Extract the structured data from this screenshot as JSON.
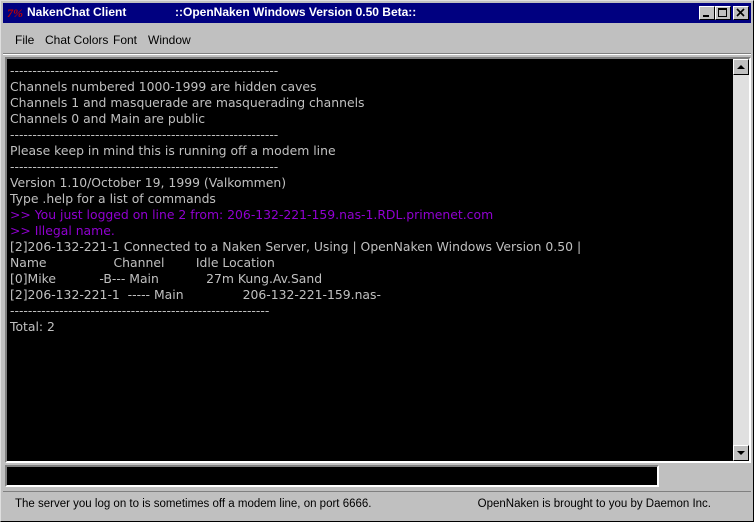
{
  "window": {
    "app_title": "NakenChat Client",
    "doc_title": "::OpenNaken Windows Version 0.50 Beta::",
    "icon_glyph": "7%"
  },
  "menu": {
    "file": "File",
    "chat_colors": "Chat Colors",
    "font": "Font",
    "window": "Window"
  },
  "output": {
    "background": "#000000",
    "text_color": "#c0c0c0",
    "highlight_color": "#9000d0",
    "lines": [
      {
        "text": "------------------------------------------------------------",
        "style": "normal"
      },
      {
        "text": "Channels numbered 1000-1999 are hidden caves",
        "style": "normal"
      },
      {
        "text": "Channels 1 and masquerade are masquerading channels",
        "style": "normal"
      },
      {
        "text": "Channels 0 and Main are public",
        "style": "normal"
      },
      {
        "text": "------------------------------------------------------------",
        "style": "normal"
      },
      {
        "text": "Please keep in mind this is running off a modem line",
        "style": "normal"
      },
      {
        "text": "------------------------------------------------------------",
        "style": "normal"
      },
      {
        "text": "Version 1.10/October 19, 1999 (Valkommen)",
        "style": "normal"
      },
      {
        "text": "Type .help for a list of commands",
        "style": "normal"
      },
      {
        "text": ">> You just logged on line 2 from: 206-132-221-159.nas-1.RDL.primenet.com",
        "style": "purple"
      },
      {
        "text": ">> Illegal name.",
        "style": "purple"
      },
      {
        "text": "[2]206-132-221-1 Connected to a Naken Server, Using | OpenNaken Windows Version 0.50 |",
        "style": "normal"
      },
      {
        "text": "Name                 Channel        Idle Location",
        "style": "normal"
      },
      {
        "text": "[0]Mike           -B--- Main            27m Kung.Av.Sand",
        "style": "normal"
      },
      {
        "text": "[2]206-132-221-1  ----- Main               206-132-221-159.nas-",
        "style": "normal"
      },
      {
        "text": "----------------------------------------------------------",
        "style": "normal"
      },
      {
        "text": "Total: 2",
        "style": "normal"
      }
    ]
  },
  "input": {
    "value": ""
  },
  "status": {
    "left": "The server you log on to is sometimes off a modem line, on port 6666.",
    "right": "OpenNaken is brought to you by Daemon Inc."
  },
  "icons": [
    "app-icon",
    "minimize-icon",
    "maximize-icon",
    "close-icon",
    "scroll-up-icon",
    "scroll-down-icon"
  ]
}
